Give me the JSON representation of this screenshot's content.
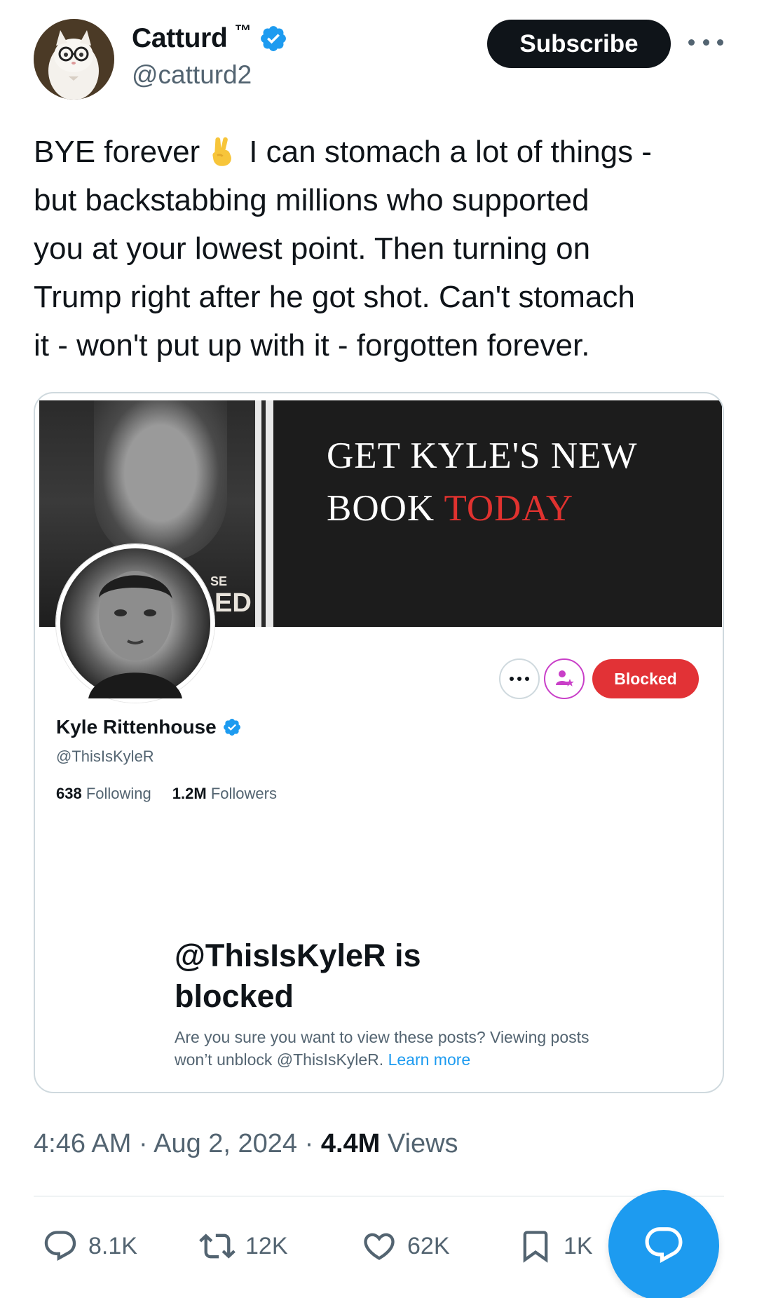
{
  "tweet": {
    "author": {
      "display_name": "Catturd",
      "trademark": "™",
      "handle": "@catturd2",
      "verified_icon": "verified-badge-icon"
    },
    "subscribe_label": "Subscribe",
    "more_icon": "more-options-icon",
    "text_lines": [
      "BYE forever",
      "I can stomach a lot of things -",
      "but backstabbing millions who supported",
      "you at your lowest point. Then turning on",
      "Trump right after he got shot. Can't stomach",
      "it - won't put up with it - forgotten forever."
    ],
    "emoji": "victory-hand-emoji",
    "timestamp": "4:46 AM · Aug 2, 2024 · ",
    "views_count": "4.4M",
    "views_label": " Views",
    "actions": {
      "reply_count": "8.1K",
      "retweet_count": "12K",
      "like_count": "62K",
      "bookmark_count": "1K"
    },
    "compose_icon": "compose-reply-icon"
  },
  "embedded_profile": {
    "banner_line1": "GET KYLE'S NEW",
    "banner_line2_white": "BOOK ",
    "banner_line2_red": "TODAY",
    "book_letters_se": "SE",
    "book_letters_ed": "ED",
    "name": "Kyle Rittenhouse",
    "handle": "@ThisIsKyleR",
    "following_count": "638",
    "following_label": "Following",
    "followers_count": "1.2M",
    "followers_label": "Followers",
    "blocked_button": "Blocked",
    "blocked_title_line1": "@ThisIsKyleR is",
    "blocked_title_line2": "blocked",
    "blocked_desc": "Are you sure you want to view these posts? Viewing posts won’t unblock @ThisIsKyleR. ",
    "learn_more": "Learn more"
  },
  "colors": {
    "verified_blue": "#1d9bf0",
    "blocked_red": "#e23236",
    "banner_red": "#e0322f",
    "subscriptions_purple": "#c93fc8"
  }
}
